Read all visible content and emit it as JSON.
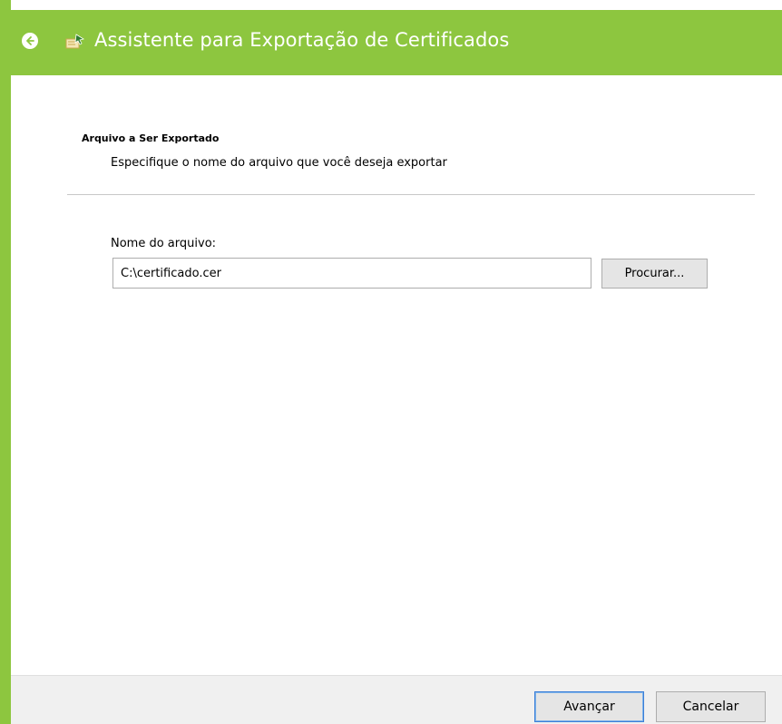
{
  "window": {
    "title": "Assistente para Exportação de Certificados",
    "accent_color": "#8dc63f",
    "back_icon": "back-arrow-icon",
    "app_icon": "certificate-wizard-icon"
  },
  "section": {
    "heading": "Arquivo a Ser Exportado",
    "description": "Especifique o nome do arquivo que você deseja exportar"
  },
  "file_field": {
    "label": "Nome do arquivo:",
    "value": "C:\\certificado.cer",
    "browse_label": "Procurar..."
  },
  "footer": {
    "next_label": "Avançar",
    "cancel_label": "Cancelar"
  }
}
